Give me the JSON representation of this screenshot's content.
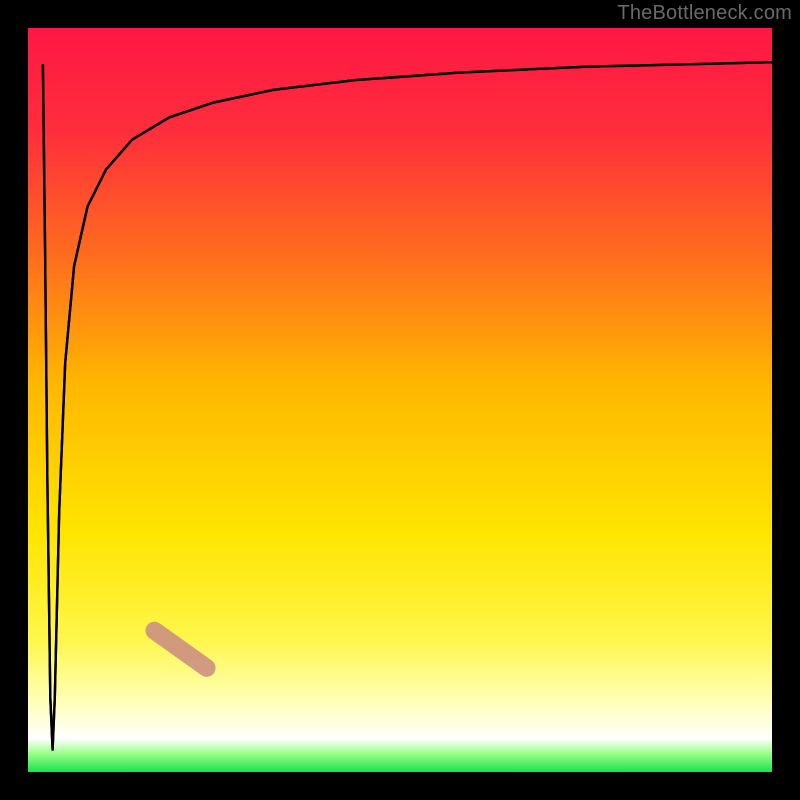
{
  "watermark": "TheBottleneck.com",
  "chart_data": {
    "type": "line",
    "title": "",
    "xlabel": "",
    "ylabel": "",
    "xlim": [
      0,
      100
    ],
    "ylim": [
      0,
      100
    ],
    "grid": false,
    "background_gradient": {
      "stops": [
        {
          "offset": 0.0,
          "color": "#ff1745"
        },
        {
          "offset": 0.14,
          "color": "#ff2e3b"
        },
        {
          "offset": 0.3,
          "color": "#ff6a1f"
        },
        {
          "offset": 0.48,
          "color": "#ffb700"
        },
        {
          "offset": 0.68,
          "color": "#ffe500"
        },
        {
          "offset": 0.82,
          "color": "#fff64a"
        },
        {
          "offset": 0.9,
          "color": "#ffffb0"
        },
        {
          "offset": 0.955,
          "color": "#ffffff"
        },
        {
          "offset": 0.975,
          "color": "#9bff8a"
        },
        {
          "offset": 1.0,
          "color": "#19e24c"
        }
      ]
    },
    "series": [
      {
        "name": "left-edge-drop",
        "x": [
          2.2,
          2.5,
          2.9,
          3.3
        ],
        "values": [
          3.0,
          50.0,
          80.0,
          97.0
        ]
      },
      {
        "name": "bottleneck-curve",
        "x": [
          3.3,
          4.2,
          5.5,
          7.5,
          10.0,
          14.0,
          19.0,
          25.0,
          33.0,
          45.0,
          60.0,
          78.0,
          100.0
        ],
        "values": [
          97.0,
          63.0,
          44.0,
          31.0,
          23.0,
          17.5,
          14.0,
          11.5,
          9.8,
          8.4,
          7.4,
          6.6,
          6.0
        ]
      }
    ],
    "marker": {
      "name": "highlight-segment",
      "approx_x_range": [
        17.0,
        24.0
      ],
      "approx_y_range": [
        14.0,
        19.0
      ],
      "color": "#c98a84",
      "opacity": 0.85
    },
    "axes_border_color": "#000000"
  }
}
